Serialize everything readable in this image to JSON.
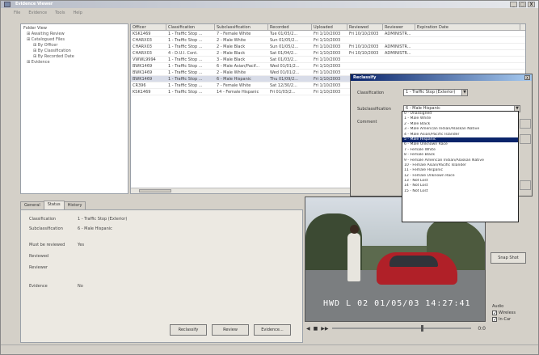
{
  "window": {
    "title": "Evidence Viewer",
    "controls": [
      "_",
      "□",
      "X"
    ]
  },
  "menu": [
    "File",
    "Evidence",
    "Tools",
    "Help"
  ],
  "tree": {
    "root": "Folder View",
    "items": [
      {
        "label": "Awaiting Review",
        "level": 1
      },
      {
        "label": "Catalogued Files",
        "level": 1
      },
      {
        "label": "By Officer",
        "level": 2
      },
      {
        "label": "By Classification",
        "level": 2
      },
      {
        "label": "By Recorded Date",
        "level": 2
      },
      {
        "label": "Evidence",
        "level": 1
      }
    ]
  },
  "grid": {
    "columns": [
      "Officer",
      "Classification",
      "Subclassification",
      "Recorded",
      "Uploaded",
      "Reviewed",
      "Reviewer",
      "Expiration Date"
    ],
    "rows": [
      [
        "KSK1469",
        "1 - Traffic Stop ...",
        "7 - Female White",
        "Tue 01/05/2...",
        "Fri 1/10/2003",
        "Fri 10/10/2003",
        "ADMINISTR...",
        ""
      ],
      [
        "CHARX03",
        "1 - Traffic Stop ...",
        "2 - Male White",
        "Sun 01/05/2...",
        "Fri 1/10/2003",
        "",
        "",
        ""
      ],
      [
        "CHARX03",
        "1 - Traffic Stop ...",
        "2 - Male Black",
        "Sun 01/05/2...",
        "Fri 1/10/2003",
        "Fri 10/10/2003",
        "ADMINISTR...",
        ""
      ],
      [
        "CHARX03",
        "4 - D.U.I. Cont.",
        "2 - Male Black",
        "Sat 01/04/2...",
        "Fri 1/10/2003",
        "Fri 10/10/2003",
        "ADMINISTR...",
        ""
      ],
      [
        "VWWL9994",
        "1 - Traffic Stop ...",
        "3 - Male Black",
        "Sat 01/03/2...",
        "Fri 1/10/2003",
        "",
        "",
        ""
      ],
      [
        "BWK1469",
        "1 - Traffic Stop ...",
        "6 - Male Asian/Pacif...",
        "Wed 01/01/2...",
        "Fri 1/10/2003",
        "",
        "",
        ""
      ],
      [
        "BWK1469",
        "1 - Traffic Stop ...",
        "2 - Male White",
        "Wed 01/01/2...",
        "Fri 1/10/2003",
        "",
        "",
        ""
      ],
      [
        "BWK1469",
        "1 - Traffic Stop ...",
        "6 - Male Hispanic",
        "Thu 01/09/2...",
        "Fri 1/10/2003",
        "",
        "",
        ""
      ],
      [
        "CR396",
        "1 - Traffic Stop ...",
        "7 - Female White",
        "Sat 12/30/2...",
        "Fri 1/10/2003",
        "",
        "",
        ""
      ],
      [
        "KSK1469",
        "1 - Traffic Stop ...",
        "14 - Female Hispanic",
        "Fri 01/03/2...",
        "Fri 1/10/2003",
        "",
        "",
        ""
      ]
    ],
    "selected_row": 7
  },
  "tabs": [
    "General",
    "Status",
    "History"
  ],
  "active_tab": "Status",
  "details": {
    "classification_label": "Classification",
    "classification_value": "1 - Traffic Stop (Exterior)",
    "subclassification_label": "Subclassification",
    "subclassification_value": "6 - Male Hispanic",
    "must_be_reviewed_label": "Must be reviewed",
    "must_be_reviewed_value": "Yes",
    "reviewed_label": "Reviewed",
    "reviewer_label": "Reviewer",
    "evidence_label": "Evidence",
    "evidence_value": "No"
  },
  "detail_buttons": [
    "Reclassify",
    "Review",
    "Evidence..."
  ],
  "video": {
    "overlay": "HWD  L 02 01/05/03 14:27:41",
    "controls": [
      "◀",
      "■",
      "▶▶"
    ],
    "position": 0.64,
    "time_label": "0:0"
  },
  "snap_button": "Snap Shot",
  "audio": {
    "label": "Audio",
    "options": [
      {
        "label": "Wireless",
        "checked": true
      },
      {
        "label": "In-Car",
        "checked": true
      }
    ]
  },
  "dialog": {
    "title": "Reclassify",
    "close": "X",
    "classification_label": "Classification",
    "classification_value": "1 - Traffic Stop (Exterior)",
    "subclassification_label": "Subclassification",
    "subclassification_value": "6 - Male Hispanic",
    "comment_label": "Comment",
    "options": [
      "0 - Unassigned",
      "1 - Male White",
      "2 - Male Black",
      "3 - Male American Indian/Alaskan Native",
      "4 - Male Asian/Pacific Islander",
      "5 - Male Hispanic",
      "6 - Male Unknown Race",
      "7 - Female White",
      "8 - Female Black",
      "9 - Female American Indian/Alaskan Native",
      "10 - Female Asian/Pacific Islander",
      "11 - Female Hispanic",
      "12 - Female Unknown Race",
      "13 - Not Lost",
      "14 - Not Lost",
      "15 - Not Lost"
    ],
    "selected_option": 5
  }
}
